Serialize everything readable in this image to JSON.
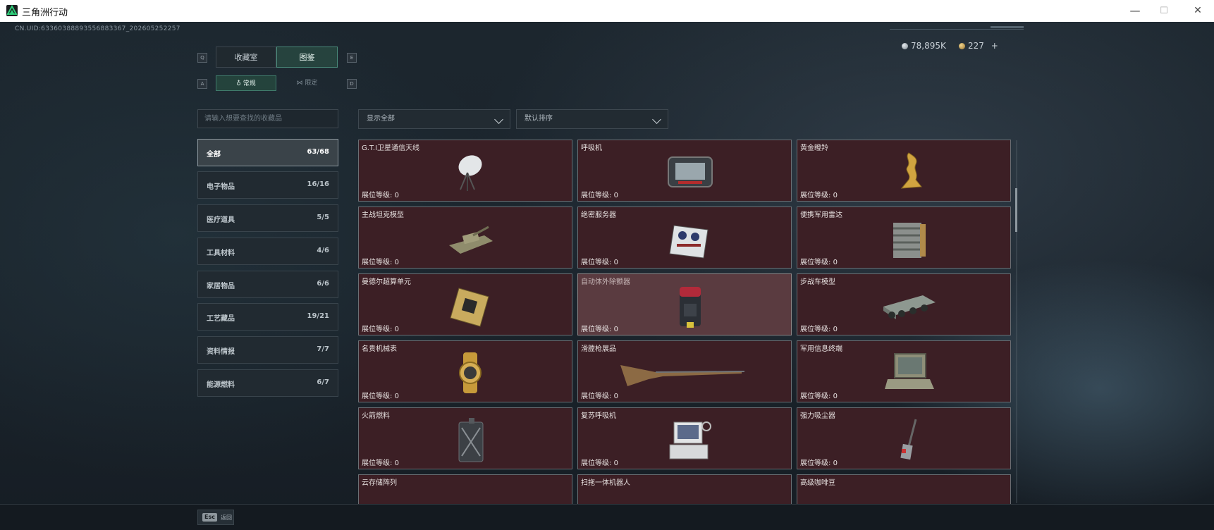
{
  "window": {
    "title": "三角洲行动",
    "minimize": "—",
    "maximize": "☐",
    "close": "✕"
  },
  "uid": "CN.UID:63360388893556883367_202605252257",
  "currency": [
    {
      "value": "78,895K",
      "color": "#b9c2c9"
    },
    {
      "value": "227",
      "color": "#c9a55c",
      "add": "+"
    }
  ],
  "tabs": {
    "hint_left": "Q",
    "hint_right": "E",
    "items": [
      "收藏室",
      "图鉴"
    ],
    "active": 1
  },
  "subtabs": {
    "hint_left": "A",
    "hint_right": "D",
    "items": [
      "常规",
      "限定"
    ],
    "active": 0
  },
  "search": {
    "placeholder": "请输入想要查找的收藏品"
  },
  "categories": [
    {
      "name": "全部",
      "count": "63/68",
      "active": true
    },
    {
      "name": "电子物品",
      "count": "16/16"
    },
    {
      "name": "医疗道具",
      "count": "5/5"
    },
    {
      "name": "工具材料",
      "count": "4/6"
    },
    {
      "name": "家居物品",
      "count": "6/6"
    },
    {
      "name": "工艺藏品",
      "count": "19/21"
    },
    {
      "name": "资料情报",
      "count": "7/7"
    },
    {
      "name": "能源燃料",
      "count": "6/7"
    }
  ],
  "filters": {
    "show": "显示全部",
    "sort": "默认排序"
  },
  "level_label": "展位等级: ",
  "items": [
    {
      "name": "G.T.I卫星通信天线",
      "level": "0",
      "icon": "satellite-dish-icon"
    },
    {
      "name": "呼吸机",
      "level": "0",
      "icon": "ventilator-icon"
    },
    {
      "name": "黄金瞪羚",
      "level": "0",
      "icon": "golden-gazelle-icon"
    },
    {
      "name": "主战坦克模型",
      "level": "0",
      "icon": "tank-model-icon"
    },
    {
      "name": "绝密服务器",
      "level": "0",
      "icon": "server-icon"
    },
    {
      "name": "便携军用雷达",
      "level": "0",
      "icon": "radar-icon"
    },
    {
      "name": "曼德尔超算单元",
      "level": "0",
      "icon": "supercomputer-unit-icon"
    },
    {
      "name": "自动体外除颤器",
      "level": "0",
      "icon": "defibrillator-icon",
      "highlight": true
    },
    {
      "name": "步战车模型",
      "level": "0",
      "icon": "ifv-model-icon"
    },
    {
      "name": "名贵机械表",
      "level": "0",
      "icon": "watch-icon"
    },
    {
      "name": "滑膛枪展品",
      "level": "0",
      "icon": "musket-icon"
    },
    {
      "name": "军用信息终端",
      "level": "0",
      "icon": "terminal-icon"
    },
    {
      "name": "火箭燃料",
      "level": "0",
      "icon": "fuel-can-icon"
    },
    {
      "name": "复苏呼吸机",
      "level": "0",
      "icon": "resuscitator-icon"
    },
    {
      "name": "强力吸尘器",
      "level": "0",
      "icon": "vacuum-icon"
    },
    {
      "name": "云存储阵列",
      "level": "",
      "icon": ""
    },
    {
      "name": "扫拖一体机器人",
      "level": "",
      "icon": ""
    },
    {
      "name": "高级咖啡豆",
      "level": "",
      "icon": ""
    }
  ],
  "footer": {
    "key": "Esc",
    "label": "返回"
  }
}
